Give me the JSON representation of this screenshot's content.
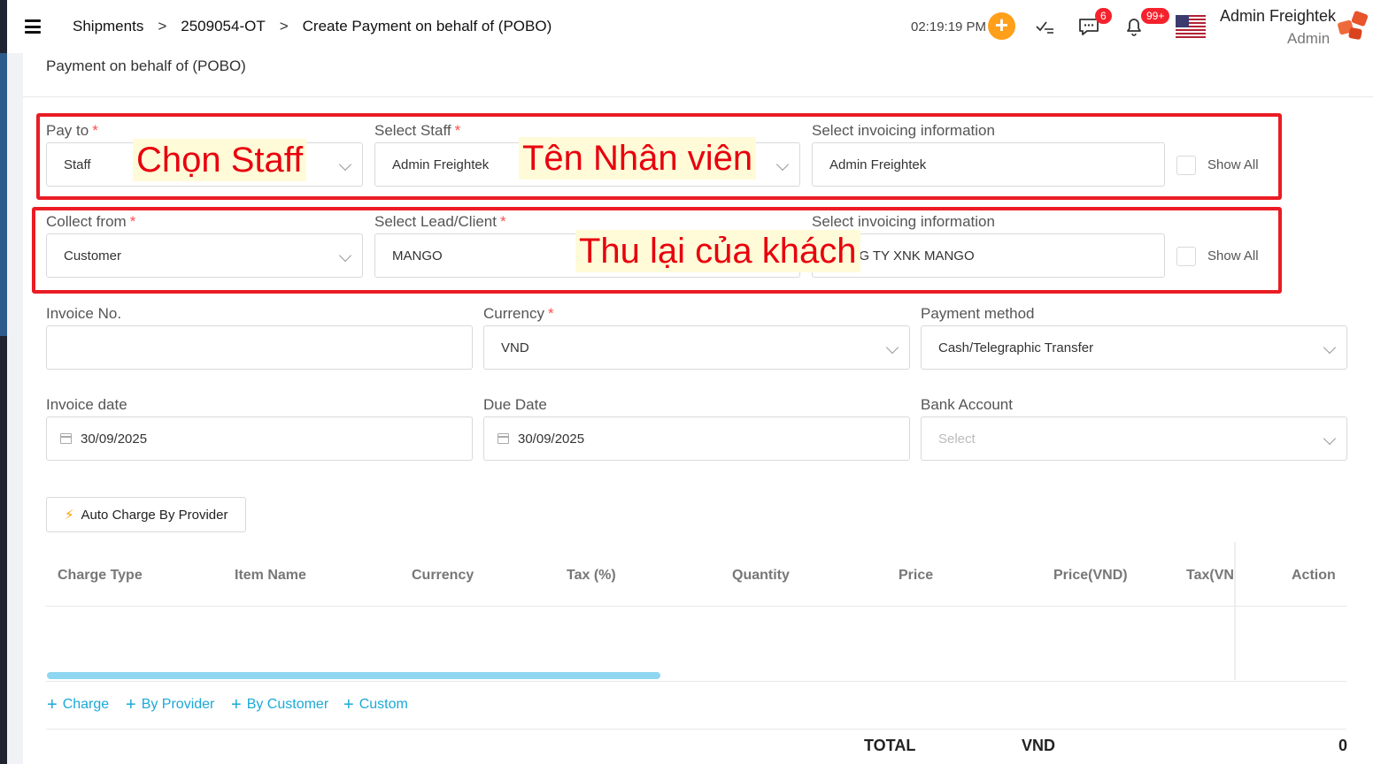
{
  "header": {
    "breadcrumb": [
      "Shipments",
      "2509054-OT",
      "Create Payment on behalf of (POBO)"
    ],
    "separator": ">",
    "clock": "02:19:19 PM",
    "messages_badge": "6",
    "notifications_badge": "99+",
    "user_name": "Admin Freightek",
    "user_role": "Admin"
  },
  "card": {
    "title": "Payment on behalf of (POBO)"
  },
  "pay_to": {
    "label": "Pay to",
    "value": "Staff",
    "staff_label": "Select Staff",
    "staff_value": "Admin Freightek",
    "invoicing_label": "Select invoicing information",
    "invoicing_value": "Admin Freightek",
    "show_all": "Show All"
  },
  "collect_from": {
    "label": "Collect from",
    "value": "Customer",
    "client_label": "Select Lead/Client",
    "client_value": "MANGO",
    "invoicing_label": "Select invoicing information",
    "invoicing_value": "CÔNG TY XNK MANGO",
    "show_all": "Show All"
  },
  "annotations": {
    "staff": "Chọn Staff",
    "staff_name": "Tên Nhân viên",
    "collect": "Thu lại của khách"
  },
  "invoice": {
    "no_label": "Invoice No.",
    "no_value": "",
    "currency_label": "Currency",
    "currency_value": "VND",
    "method_label": "Payment method",
    "method_value": "Cash/Telegraphic Transfer",
    "date_label": "Invoice date",
    "date_value": "30/09/2025",
    "due_label": "Due Date",
    "due_value": "30/09/2025",
    "bank_label": "Bank Account",
    "bank_placeholder": "Select"
  },
  "auto_charge": "Auto Charge By Provider",
  "table": {
    "headers": [
      "Charge Type",
      "Item Name",
      "Currency",
      "Tax (%)",
      "Quantity",
      "Price",
      "Price(VND)",
      "Tax(VN",
      "Action"
    ]
  },
  "add_links": [
    "Charge",
    "By Provider",
    "By Customer",
    "Custom"
  ],
  "totals": {
    "label": "TOTAL",
    "currency": "VND",
    "amount": "0"
  },
  "colors": {
    "accent": "#1ba9d8",
    "annotation_red": "#ea1c24",
    "orange": "#ff9f1a"
  }
}
